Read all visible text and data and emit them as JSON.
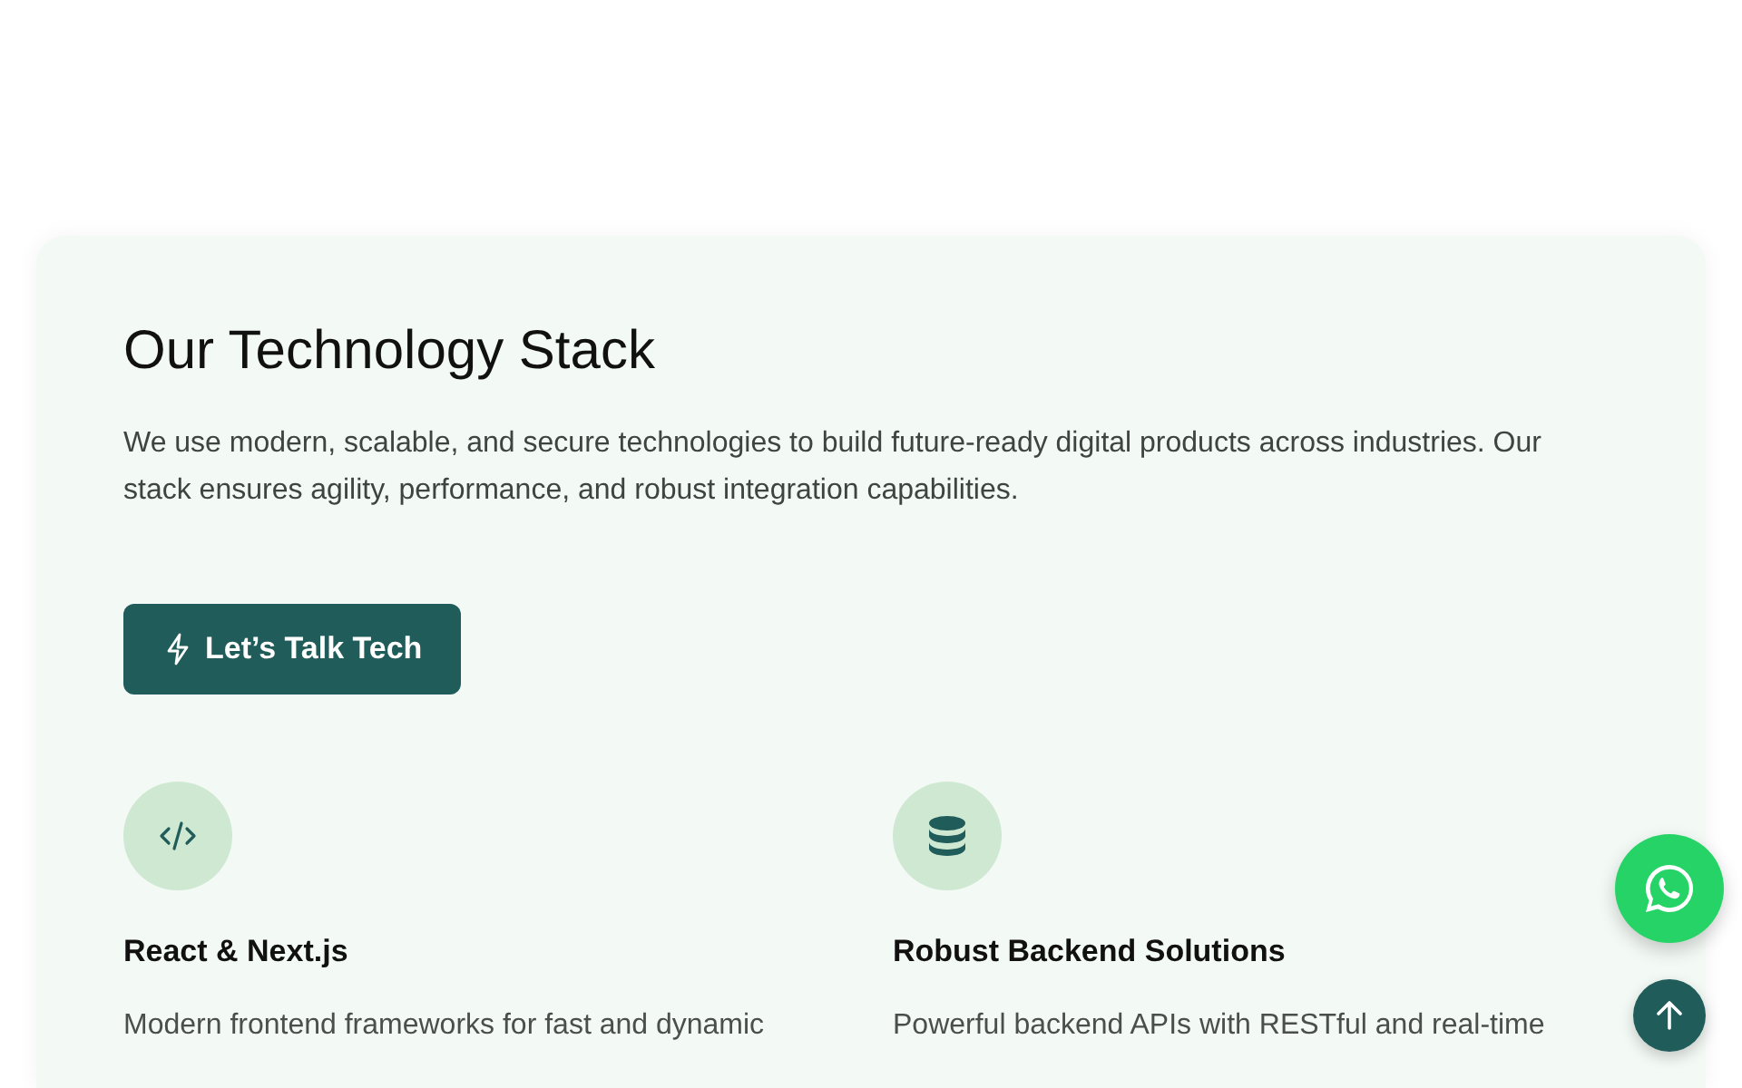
{
  "section": {
    "title": "Our Technology Stack",
    "description": "We use modern, scalable, and secure technologies to build future-ready digital products across industries. Our stack ensures agility, performance, and robust integration capabilities.",
    "cta": {
      "label": "Let’s Talk Tech"
    }
  },
  "features": [
    {
      "kind": "code",
      "title": "React & Next.js",
      "description": "Modern frontend frameworks for fast and dynamic"
    },
    {
      "kind": "database",
      "title": "Robust Backend Solutions",
      "description": "Powerful backend APIs with RESTful and real-time"
    }
  ]
}
